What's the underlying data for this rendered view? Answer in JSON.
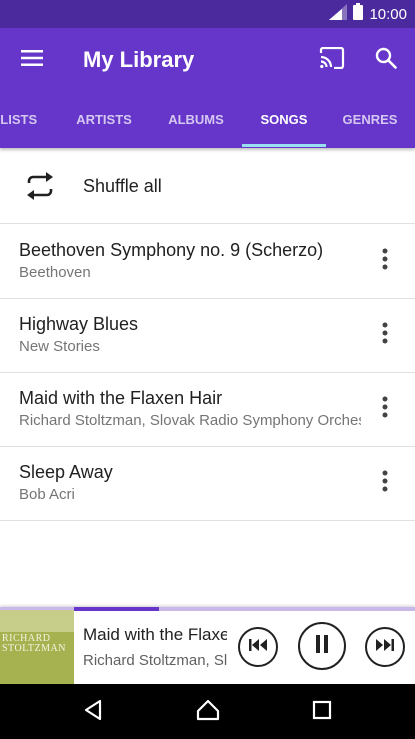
{
  "status_bar": {
    "time": "10:00",
    "icons": [
      "signal-icon",
      "battery-icon"
    ]
  },
  "app_bar": {
    "title": "My Library",
    "icons": [
      "menu-icon",
      "cast-icon",
      "search-icon"
    ]
  },
  "tabs": [
    {
      "label": "PLAYLISTS",
      "active": false
    },
    {
      "label": "ARTISTS",
      "active": false
    },
    {
      "label": "ALBUMS",
      "active": false
    },
    {
      "label": "SONGS",
      "active": true
    },
    {
      "label": "GENRES",
      "active": false
    }
  ],
  "shuffle": {
    "label": "Shuffle all",
    "icon": "shuffle-icon"
  },
  "songs": [
    {
      "title": "Beethoven Symphony no. 9 (Scherzo)",
      "artist": "Beethoven"
    },
    {
      "title": "Highway Blues",
      "artist": "New Stories"
    },
    {
      "title": "Maid with the Flaxen Hair",
      "artist": "Richard Stoltzman, Slovak Radio Symphony Orchestra"
    },
    {
      "title": "Sleep Away",
      "artist": "Bob Acri"
    }
  ],
  "now_playing": {
    "title": "Maid with the Flaxen Hair",
    "artist": "Richard Stoltzman, Slovak Radio Symphony Orchestra",
    "album_art_text": "RICHARD STOLTZMAN",
    "progress": 0.25
  },
  "colors": {
    "status_bar": "#4b2a9e",
    "primary": "#6536c9",
    "tab_indicator": "#9be0f0"
  },
  "nav_bar": {
    "icons": [
      "back-icon",
      "home-icon",
      "recents-icon"
    ]
  }
}
